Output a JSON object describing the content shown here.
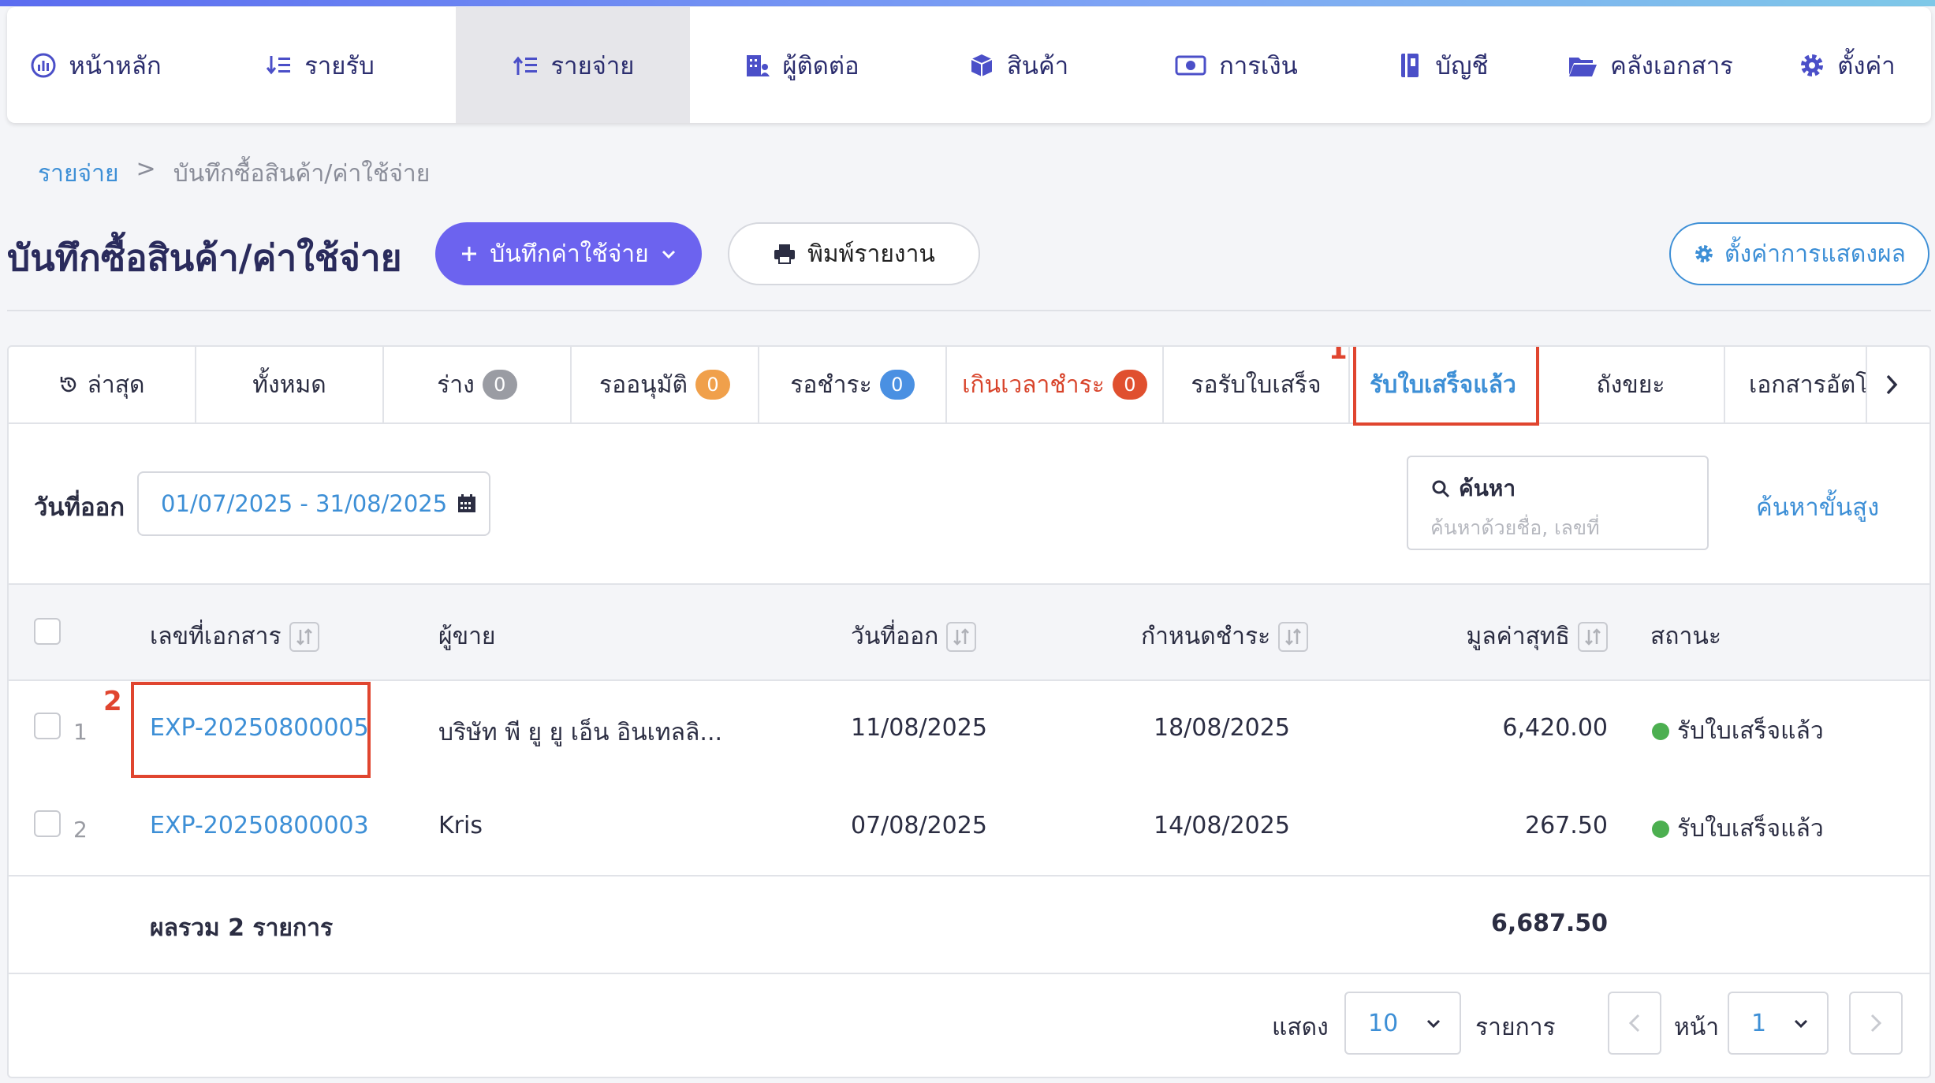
{
  "nav": {
    "items": [
      {
        "label": "หน้าหลัก",
        "icon": "dashboard-icon"
      },
      {
        "label": "รายรับ",
        "icon": "income-sort-icon"
      },
      {
        "label": "รายจ่าย",
        "icon": "expense-sort-icon",
        "active": true
      },
      {
        "label": "ผู้ติดต่อ",
        "icon": "contacts-building-icon"
      },
      {
        "label": "สินค้า",
        "icon": "product-box-icon"
      },
      {
        "label": "การเงิน",
        "icon": "money-icon"
      },
      {
        "label": "บัญชี",
        "icon": "ledger-book-icon"
      },
      {
        "label": "คลังเอกสาร",
        "icon": "folder-open-icon"
      },
      {
        "label": "ตั้งค่า",
        "icon": "gear-icon"
      }
    ]
  },
  "breadcrumb": {
    "root": "รายจ่าย",
    "sep": ">",
    "current": "บันทึกซื้อสินค้า/ค่าใช้จ่าย"
  },
  "header": {
    "title": "บันทึกซื้อสินค้า/ค่าใช้จ่าย",
    "add_button": "บันทึกค่าใช้จ่าย",
    "print_button": "พิมพ์รายงาน",
    "display_settings_button": "ตั้งค่าการแสดงผล"
  },
  "tabs": [
    {
      "label": "ล่าสุด",
      "icon": "history-icon"
    },
    {
      "label": "ทั้งหมด"
    },
    {
      "label": "ร่าง",
      "count": "0",
      "badge": "#9a9ca3"
    },
    {
      "label": "รออนุมัติ",
      "count": "0",
      "badge": "#f0a04b"
    },
    {
      "label": "รอชำระ",
      "count": "0",
      "badge": "#4a90e2"
    },
    {
      "label": "เกินเวลาชำระ",
      "count": "0",
      "badge": "#e0502f"
    },
    {
      "label": "รอรับใบเสร็จ"
    },
    {
      "label": "รับใบเสร็จแล้ว",
      "active": true
    },
    {
      "label": "ถังขยะ"
    },
    {
      "label": "เอกสารอัตโ"
    }
  ],
  "annotations": {
    "tab_marker": "1",
    "row_marker": "2"
  },
  "filter": {
    "date_label": "วันที่ออก",
    "date_range": "01/07/2025 - 31/08/2025",
    "search_label": "ค้นหา",
    "search_placeholder": "ค้นหาด้วยชื่อ, เลขที่",
    "advanced_search": "ค้นหาขั้นสูง"
  },
  "table": {
    "columns": {
      "doc_no": "เลขที่เอกสาร",
      "vendor": "ผู้ขาย",
      "issue_date": "วันที่ออก",
      "due_date": "กำหนดชำระ",
      "net_amount": "มูลค่าสุทธิ",
      "status": "สถานะ"
    },
    "rows": [
      {
        "index": "1",
        "doc_no": "EXP-20250800005",
        "vendor": "บริษัท พี ยู ยู เอ็น อินเทลลิ...",
        "issue_date": "11/08/2025",
        "due_date": "18/08/2025",
        "net_amount": "6,420.00",
        "status": "รับใบเสร็จแล้ว"
      },
      {
        "index": "2",
        "doc_no": "EXP-20250800003",
        "vendor": "Kris",
        "issue_date": "07/08/2025",
        "due_date": "14/08/2025",
        "net_amount": "267.50",
        "status": "รับใบเสร็จแล้ว"
      }
    ],
    "total_label": "ผลรวม 2 รายการ",
    "total_amount": "6,687.50"
  },
  "pagination": {
    "show_label": "แสดง",
    "page_size": "10",
    "items_label": "รายการ",
    "page_label": "หน้า",
    "page": "1"
  },
  "colors": {
    "accent": "#6c63ef",
    "link": "#3d8fd6",
    "highlight": "#e0452f",
    "status_ok": "#4caf50"
  }
}
